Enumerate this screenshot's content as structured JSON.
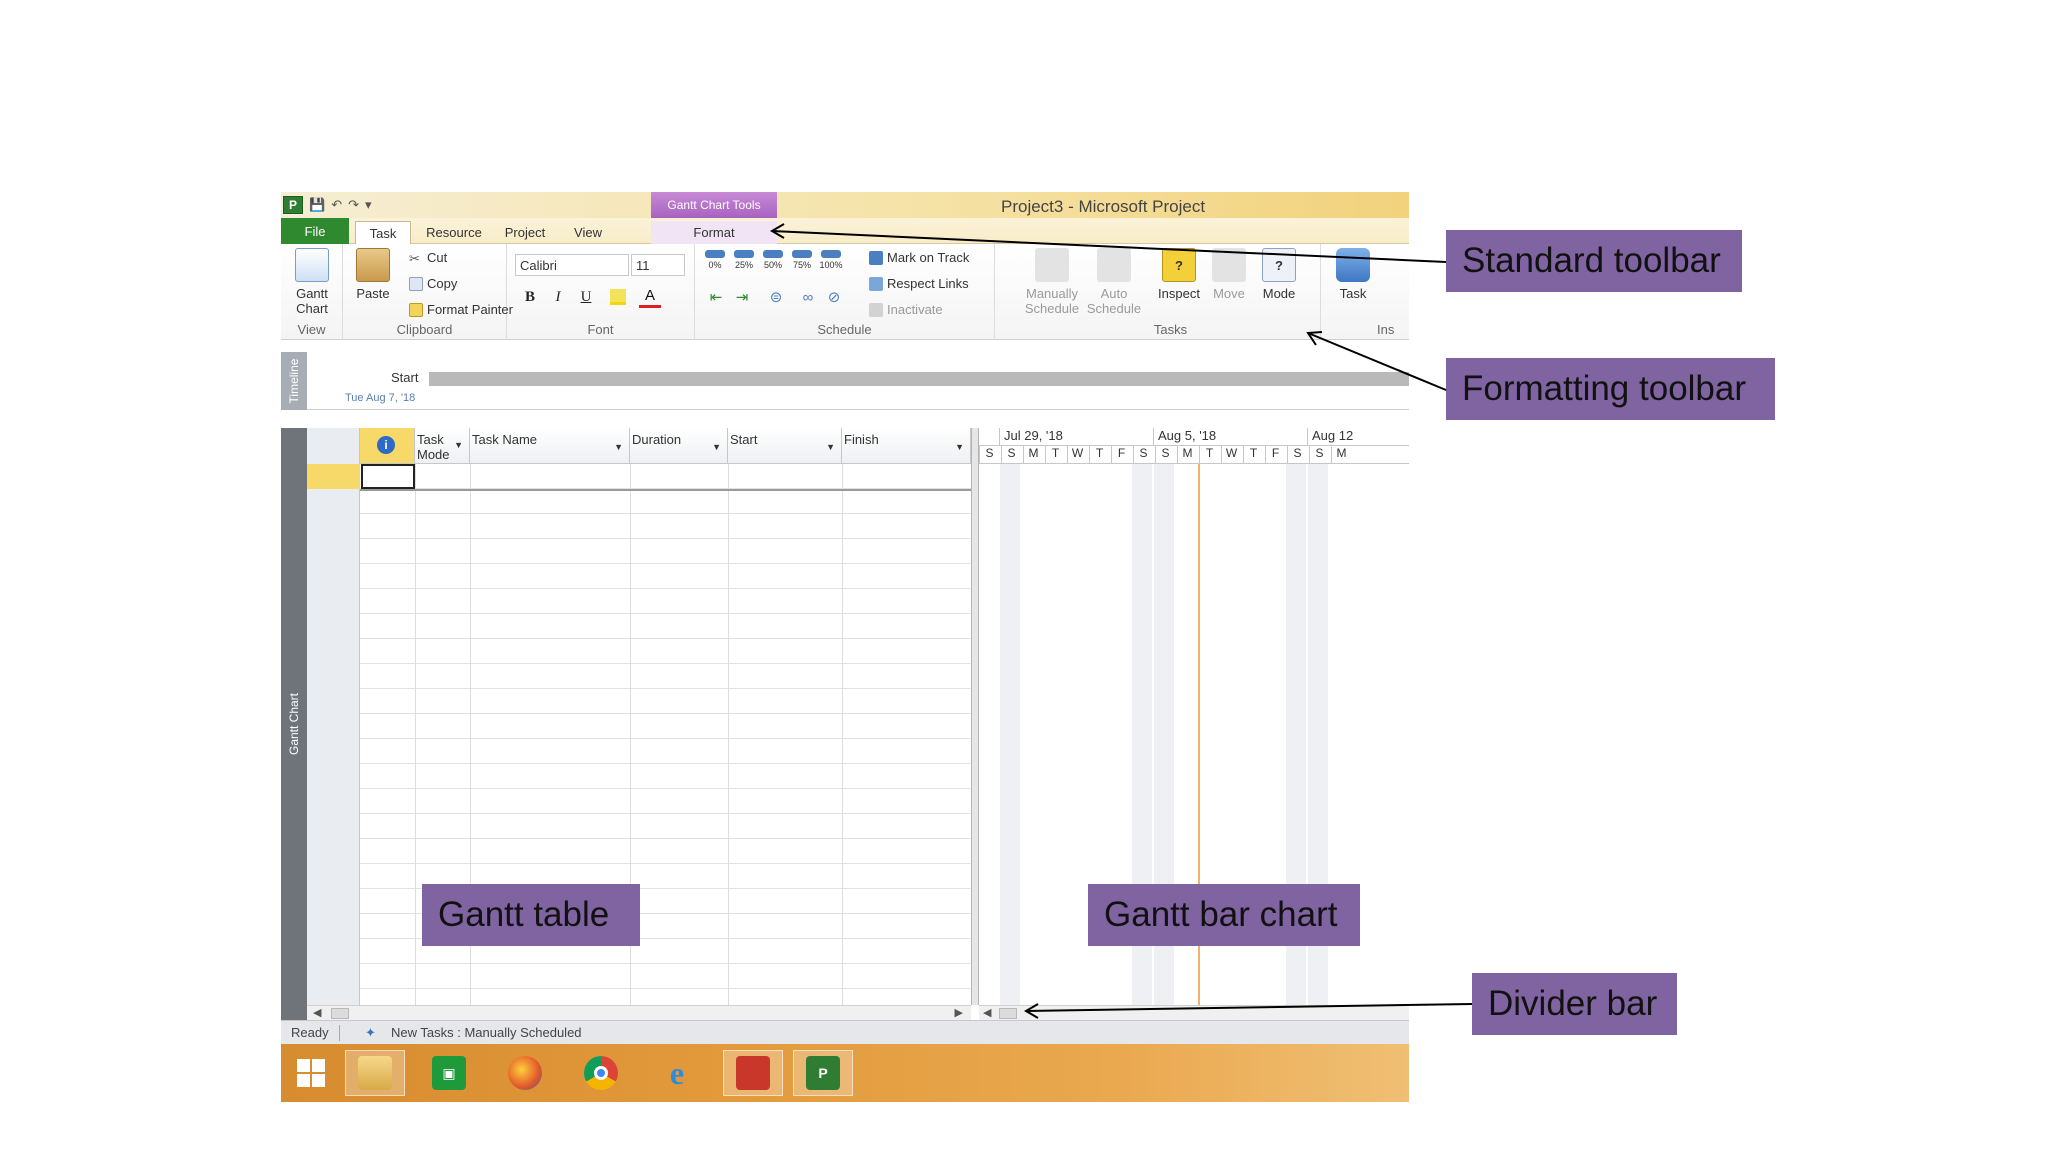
{
  "window": {
    "title": "Project3  -  Microsoft Project",
    "contextual_tools": "Gantt Chart Tools",
    "app_logo": "P"
  },
  "tabs": [
    "File",
    "Task",
    "Resource",
    "Project",
    "View",
    "Format"
  ],
  "ribbon": {
    "view": {
      "gantt_label": "Gantt",
      "gantt_label2": "Chart",
      "group": "View"
    },
    "clipboard": {
      "paste": "Paste",
      "cut": "Cut",
      "copy": "Copy",
      "format_painter": "Format Painter",
      "group": "Clipboard"
    },
    "font": {
      "name": "Calibri",
      "size": "11",
      "bold": "B",
      "italic": "I",
      "underline": "U",
      "color_letter": "A",
      "group": "Font"
    },
    "schedule": {
      "percents": [
        "0%",
        "25%",
        "50%",
        "75%",
        "100%"
      ],
      "mark_on_track": "Mark on Track",
      "respect_links": "Respect Links",
      "inactivate": "Inactivate",
      "group": "Schedule"
    },
    "tasks": {
      "manually": "Manually",
      "manually2": "Schedule",
      "auto": "Auto",
      "auto2": "Schedule",
      "inspect": "Inspect",
      "move": "Move",
      "mode": "Mode",
      "group": "Tasks"
    },
    "insert": {
      "task": "Task",
      "group": "Ins"
    }
  },
  "timeline": {
    "side_label": "Timeline",
    "start_label": "Start",
    "start_date": "Tue Aug 7, '18"
  },
  "gantt": {
    "side_label": "Gantt Chart",
    "columns": [
      {
        "label": "Task",
        "label2": "Mode"
      },
      {
        "label": "Task Name"
      },
      {
        "label": "Duration"
      },
      {
        "label": "Start"
      },
      {
        "label": "Finish"
      }
    ],
    "info_symbol": "i",
    "weeks": [
      "Jul 29, '18",
      "Aug 5, '18",
      "Aug 12"
    ],
    "days": [
      "S",
      "S",
      "M",
      "T",
      "W",
      "T",
      "F",
      "S",
      "S",
      "M",
      "T",
      "W",
      "T",
      "F",
      "S",
      "S",
      "M"
    ]
  },
  "status": {
    "ready": "Ready",
    "new_tasks": "New Tasks : Manually Scheduled"
  },
  "annotations": {
    "standard_toolbar": "Standard toolbar",
    "formatting_toolbar": "Formatting toolbar",
    "gantt_table": "Gantt table",
    "gantt_bar_chart": "Gantt bar chart",
    "divider_bar": "Divider bar"
  },
  "colors": {
    "callout_bg": "#8064a2",
    "file_tab": "#2f8a2f",
    "contextual_tab": "#b06fc6",
    "selection": "#f7d96a",
    "taskbar": "#e29a3b"
  }
}
